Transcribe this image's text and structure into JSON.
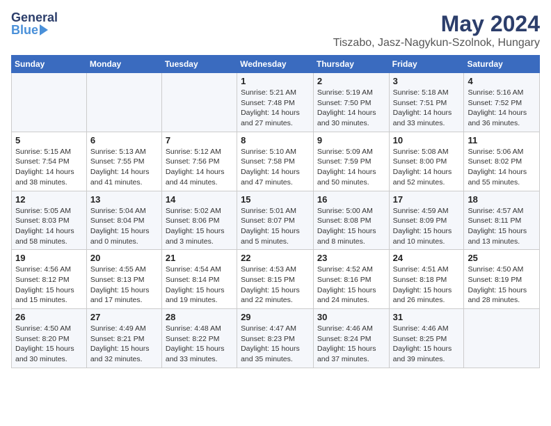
{
  "header": {
    "logo_general": "General",
    "logo_blue": "Blue",
    "month_year": "May 2024",
    "location": "Tiszabo, Jasz-Nagykun-Szolnok, Hungary"
  },
  "weekdays": [
    "Sunday",
    "Monday",
    "Tuesday",
    "Wednesday",
    "Thursday",
    "Friday",
    "Saturday"
  ],
  "weeks": [
    [
      {
        "day": "",
        "info": ""
      },
      {
        "day": "",
        "info": ""
      },
      {
        "day": "",
        "info": ""
      },
      {
        "day": "1",
        "info": "Sunrise: 5:21 AM\nSunset: 7:48 PM\nDaylight: 14 hours\nand 27 minutes."
      },
      {
        "day": "2",
        "info": "Sunrise: 5:19 AM\nSunset: 7:50 PM\nDaylight: 14 hours\nand 30 minutes."
      },
      {
        "day": "3",
        "info": "Sunrise: 5:18 AM\nSunset: 7:51 PM\nDaylight: 14 hours\nand 33 minutes."
      },
      {
        "day": "4",
        "info": "Sunrise: 5:16 AM\nSunset: 7:52 PM\nDaylight: 14 hours\nand 36 minutes."
      }
    ],
    [
      {
        "day": "5",
        "info": "Sunrise: 5:15 AM\nSunset: 7:54 PM\nDaylight: 14 hours\nand 38 minutes."
      },
      {
        "day": "6",
        "info": "Sunrise: 5:13 AM\nSunset: 7:55 PM\nDaylight: 14 hours\nand 41 minutes."
      },
      {
        "day": "7",
        "info": "Sunrise: 5:12 AM\nSunset: 7:56 PM\nDaylight: 14 hours\nand 44 minutes."
      },
      {
        "day": "8",
        "info": "Sunrise: 5:10 AM\nSunset: 7:58 PM\nDaylight: 14 hours\nand 47 minutes."
      },
      {
        "day": "9",
        "info": "Sunrise: 5:09 AM\nSunset: 7:59 PM\nDaylight: 14 hours\nand 50 minutes."
      },
      {
        "day": "10",
        "info": "Sunrise: 5:08 AM\nSunset: 8:00 PM\nDaylight: 14 hours\nand 52 minutes."
      },
      {
        "day": "11",
        "info": "Sunrise: 5:06 AM\nSunset: 8:02 PM\nDaylight: 14 hours\nand 55 minutes."
      }
    ],
    [
      {
        "day": "12",
        "info": "Sunrise: 5:05 AM\nSunset: 8:03 PM\nDaylight: 14 hours\nand 58 minutes."
      },
      {
        "day": "13",
        "info": "Sunrise: 5:04 AM\nSunset: 8:04 PM\nDaylight: 15 hours\nand 0 minutes."
      },
      {
        "day": "14",
        "info": "Sunrise: 5:02 AM\nSunset: 8:06 PM\nDaylight: 15 hours\nand 3 minutes."
      },
      {
        "day": "15",
        "info": "Sunrise: 5:01 AM\nSunset: 8:07 PM\nDaylight: 15 hours\nand 5 minutes."
      },
      {
        "day": "16",
        "info": "Sunrise: 5:00 AM\nSunset: 8:08 PM\nDaylight: 15 hours\nand 8 minutes."
      },
      {
        "day": "17",
        "info": "Sunrise: 4:59 AM\nSunset: 8:09 PM\nDaylight: 15 hours\nand 10 minutes."
      },
      {
        "day": "18",
        "info": "Sunrise: 4:57 AM\nSunset: 8:11 PM\nDaylight: 15 hours\nand 13 minutes."
      }
    ],
    [
      {
        "day": "19",
        "info": "Sunrise: 4:56 AM\nSunset: 8:12 PM\nDaylight: 15 hours\nand 15 minutes."
      },
      {
        "day": "20",
        "info": "Sunrise: 4:55 AM\nSunset: 8:13 PM\nDaylight: 15 hours\nand 17 minutes."
      },
      {
        "day": "21",
        "info": "Sunrise: 4:54 AM\nSunset: 8:14 PM\nDaylight: 15 hours\nand 19 minutes."
      },
      {
        "day": "22",
        "info": "Sunrise: 4:53 AM\nSunset: 8:15 PM\nDaylight: 15 hours\nand 22 minutes."
      },
      {
        "day": "23",
        "info": "Sunrise: 4:52 AM\nSunset: 8:16 PM\nDaylight: 15 hours\nand 24 minutes."
      },
      {
        "day": "24",
        "info": "Sunrise: 4:51 AM\nSunset: 8:18 PM\nDaylight: 15 hours\nand 26 minutes."
      },
      {
        "day": "25",
        "info": "Sunrise: 4:50 AM\nSunset: 8:19 PM\nDaylight: 15 hours\nand 28 minutes."
      }
    ],
    [
      {
        "day": "26",
        "info": "Sunrise: 4:50 AM\nSunset: 8:20 PM\nDaylight: 15 hours\nand 30 minutes."
      },
      {
        "day": "27",
        "info": "Sunrise: 4:49 AM\nSunset: 8:21 PM\nDaylight: 15 hours\nand 32 minutes."
      },
      {
        "day": "28",
        "info": "Sunrise: 4:48 AM\nSunset: 8:22 PM\nDaylight: 15 hours\nand 33 minutes."
      },
      {
        "day": "29",
        "info": "Sunrise: 4:47 AM\nSunset: 8:23 PM\nDaylight: 15 hours\nand 35 minutes."
      },
      {
        "day": "30",
        "info": "Sunrise: 4:46 AM\nSunset: 8:24 PM\nDaylight: 15 hours\nand 37 minutes."
      },
      {
        "day": "31",
        "info": "Sunrise: 4:46 AM\nSunset: 8:25 PM\nDaylight: 15 hours\nand 39 minutes."
      },
      {
        "day": "",
        "info": ""
      }
    ]
  ]
}
